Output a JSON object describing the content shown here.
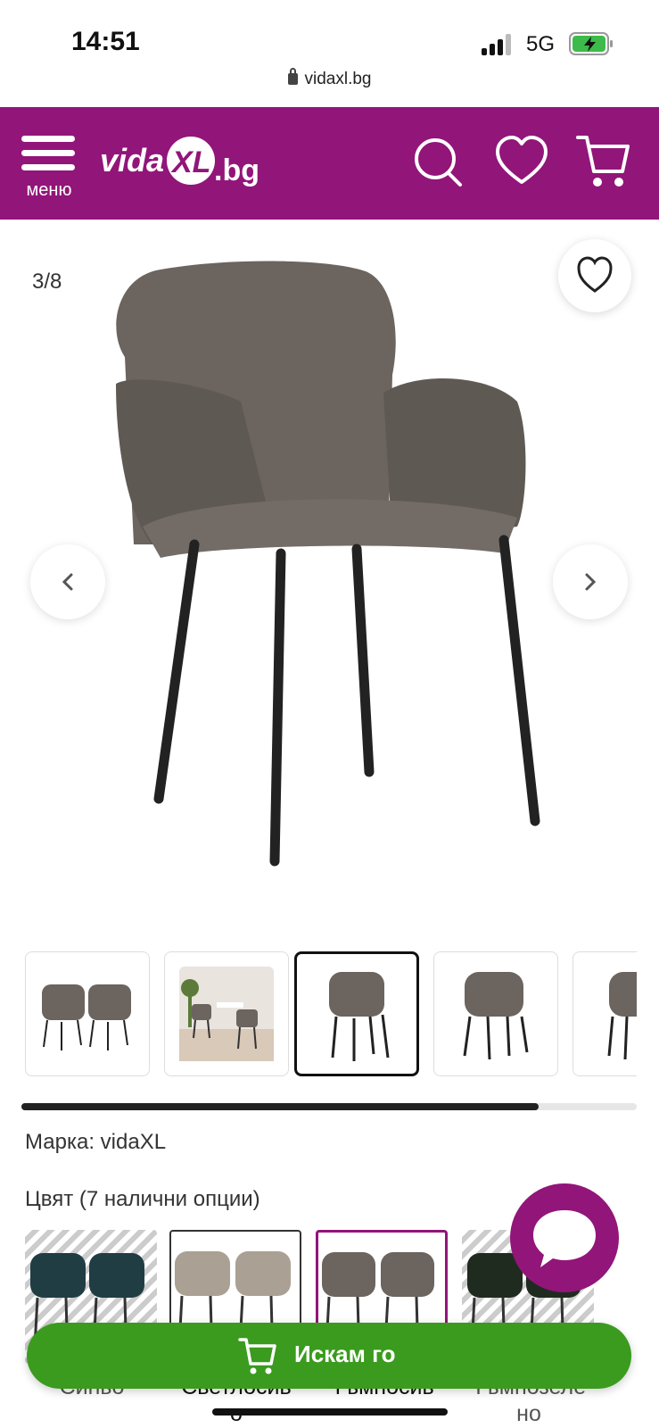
{
  "status_bar": {
    "time": "14:51",
    "network": "5G",
    "url": "vidaxl.bg"
  },
  "header": {
    "menu_label": "меню",
    "logo_text": "vidaXL.bg"
  },
  "gallery": {
    "counter": "3/8",
    "thumbnail_progress": 0.84
  },
  "product": {
    "brand_label": "Марка: vidaXL",
    "color_title": "Цвят (7 налични опции)",
    "colors": [
      {
        "name": "Синьо"
      },
      {
        "name": "Светлосив"
      },
      {
        "name": "Тъмносив"
      },
      {
        "name": "Тъмнозеле"
      }
    ],
    "color_label_overflow": [
      "о",
      "но"
    ]
  },
  "cta": {
    "buy_label": "Искам го"
  },
  "colors": {
    "brand_purple": "#921579",
    "buy_green": "#3a9b1e"
  }
}
